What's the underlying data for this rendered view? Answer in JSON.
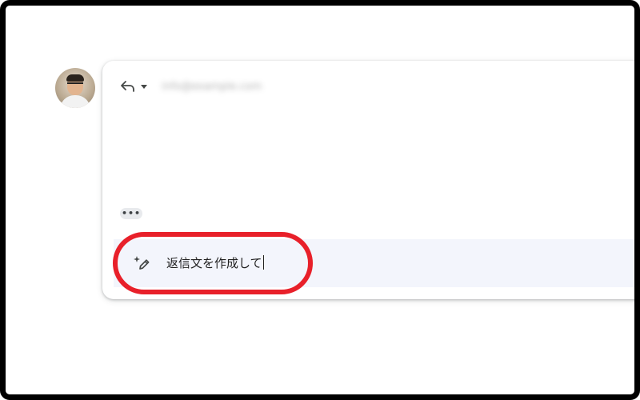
{
  "icons": {
    "avatar": "user-avatar-photo",
    "reply": "reply-arrow-icon",
    "reply_menu": "chevron-down-icon",
    "more": "ellipsis-icon",
    "ai_write": "sparkle-pencil-icon"
  },
  "colors": {
    "highlight_ring": "#e8202a",
    "prompt_background": "#f3f5fc",
    "frame_border": "#000000"
  },
  "compose": {
    "recipient": "info@example.com",
    "more_label": "•••"
  },
  "ai_prompt": {
    "value": "返信文を作成して"
  }
}
